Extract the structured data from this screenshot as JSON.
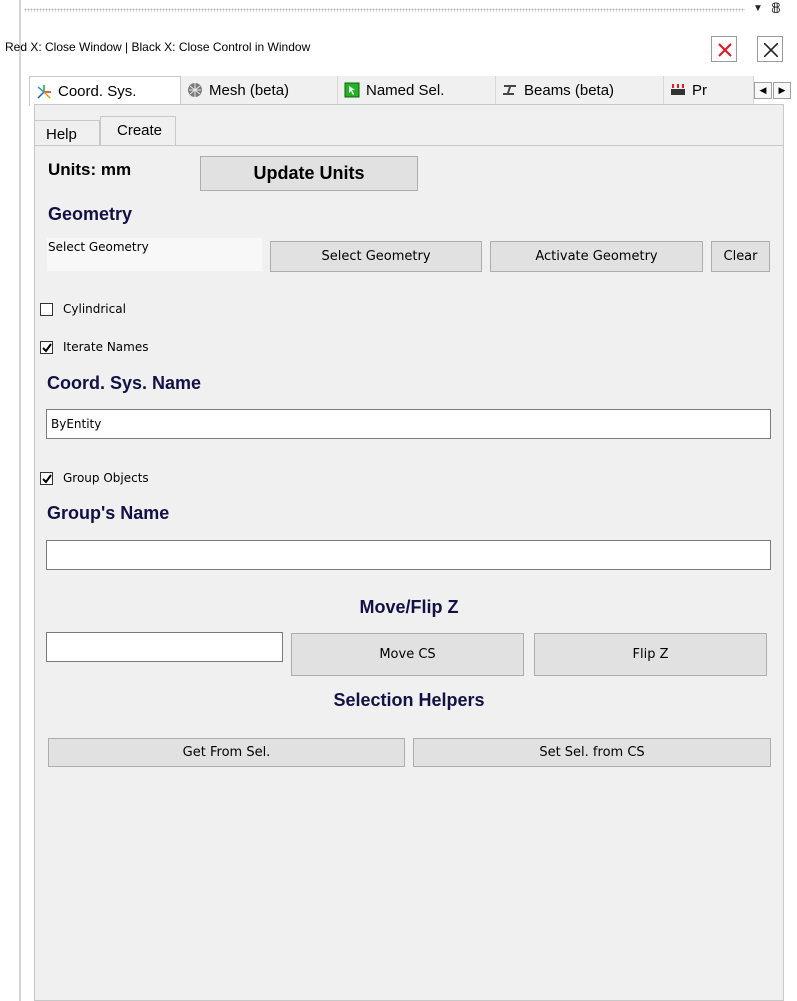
{
  "window": {
    "info_text": "Red X: Close Window | Black X: Close Control in Window"
  },
  "tabs": [
    {
      "label": "Coord. Sys.",
      "active": true
    },
    {
      "label": "Mesh (beta)",
      "active": false
    },
    {
      "label": "Named Sel.",
      "active": false
    },
    {
      "label": "Beams (beta)",
      "active": false
    },
    {
      "label": "Pr",
      "active": false
    }
  ],
  "subtabs": [
    {
      "label": "Help",
      "active": false
    },
    {
      "label": "Create",
      "active": true
    }
  ],
  "units": {
    "label": "Units: mm",
    "button": "Update Units"
  },
  "geometry": {
    "heading": "Geometry",
    "selection_text": "Select Geometry",
    "select_button": "Select Geometry",
    "activate_button": "Activate Geometry",
    "clear_button": "Clear"
  },
  "options": {
    "cylindrical": {
      "label": "Cylindrical",
      "checked": false
    },
    "iterate_names": {
      "label": "Iterate Names",
      "checked": true
    },
    "group_objects": {
      "label": "Group Objects",
      "checked": true
    }
  },
  "coord_sys_name": {
    "heading": "Coord. Sys. Name",
    "value": "ByEntity"
  },
  "group_name": {
    "heading": "Group's Name",
    "value": ""
  },
  "move_flip": {
    "heading": "Move/Flip Z",
    "value": "",
    "move_button": "Move CS",
    "flip_button": "Flip Z"
  },
  "selection_helpers": {
    "heading": "Selection Helpers",
    "get_button": "Get From Sel.",
    "set_button": "Set Sel. from CS"
  },
  "colors": {
    "heading_navy": "#111146",
    "close_red": "#e81123",
    "panel_bg": "#f0f0f0"
  }
}
